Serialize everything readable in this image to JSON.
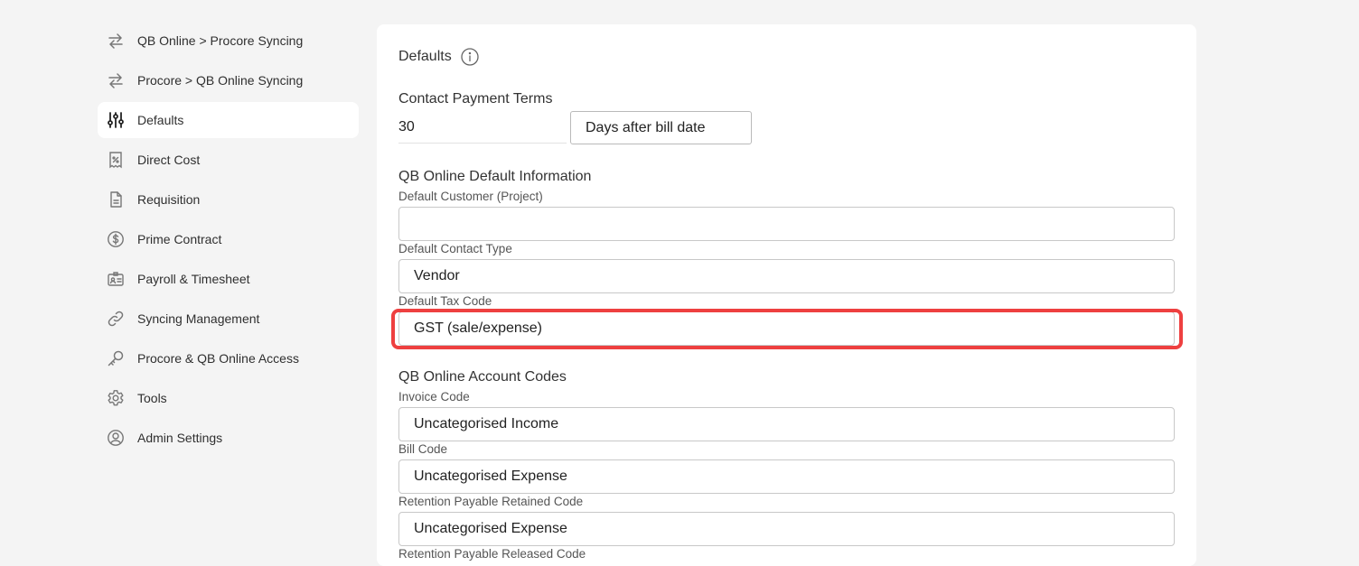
{
  "sidebar": {
    "items": [
      {
        "label": "QB Online > Procore Syncing",
        "icon": "sync-arrows-icon"
      },
      {
        "label": "Procore > QB Online Syncing",
        "icon": "sync-arrows-icon"
      },
      {
        "label": "Defaults",
        "icon": "sliders-icon"
      },
      {
        "label": "Direct Cost",
        "icon": "receipt-percent-icon"
      },
      {
        "label": "Requisition",
        "icon": "document-icon"
      },
      {
        "label": "Prime Contract",
        "icon": "dollar-circle-icon"
      },
      {
        "label": "Payroll & Timesheet",
        "icon": "id-card-icon"
      },
      {
        "label": "Syncing Management",
        "icon": "link-icon"
      },
      {
        "label": "Procore & QB Online Access",
        "icon": "key-icon"
      },
      {
        "label": "Tools",
        "icon": "gear-icon"
      },
      {
        "label": "Admin Settings",
        "icon": "user-circle-icon"
      }
    ],
    "active_index": 2
  },
  "main": {
    "title": "Defaults",
    "payment_terms": {
      "label": "Contact Payment Terms",
      "days_value": "30",
      "unit_value": "Days after bill date"
    },
    "default_info": {
      "title": "QB Online Default Information",
      "customer_label": "Default Customer (Project)",
      "customer_value": "",
      "contact_type_label": "Default Contact Type",
      "contact_type_value": "Vendor",
      "tax_code_label": "Default Tax Code",
      "tax_code_value": "GST (sale/expense)"
    },
    "account_codes": {
      "title": "QB Online Account Codes",
      "invoice_label": "Invoice Code",
      "invoice_value": "Uncategorised Income",
      "bill_label": "Bill Code",
      "bill_value": "Uncategorised Expense",
      "retention_payable_label": "Retention Payable Retained Code",
      "retention_payable_value": "Uncategorised Expense",
      "next_label": "Retention Payable Released Code"
    }
  },
  "colors": {
    "highlight": "#ee4040",
    "background": "#f4f4f4",
    "card": "#ffffff"
  }
}
